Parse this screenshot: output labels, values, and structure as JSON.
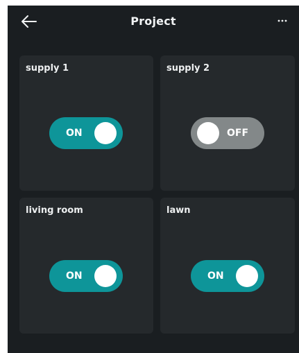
{
  "header": {
    "title": "Project",
    "back_icon": "arrow-left-icon",
    "more_icon": "more-horizontal-icon"
  },
  "colors": {
    "background": "#1a1e21",
    "card": "#25292c",
    "toggle_on": "#0e9599",
    "toggle_off": "#838889"
  },
  "cards": [
    {
      "label": "supply 1",
      "state": "ON"
    },
    {
      "label": "supply 2",
      "state": "OFF"
    },
    {
      "label": "living room",
      "state": "ON"
    },
    {
      "label": "lawn",
      "state": "ON"
    }
  ]
}
